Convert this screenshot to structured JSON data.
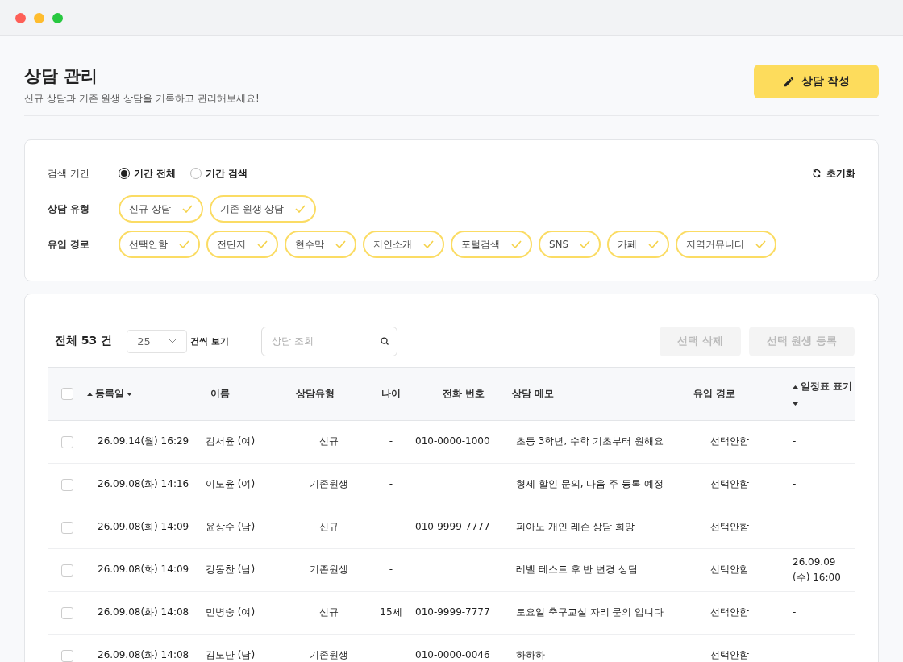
{
  "header": {
    "title": "상담 관리",
    "subtitle": "신규 상담과 기존 원생 상담을 기록하고 관리해보세요!",
    "write_button": "상담 작성"
  },
  "filters": {
    "period": {
      "label": "검색 기간",
      "options": [
        {
          "label": "기간 전체",
          "selected": true
        },
        {
          "label": "기간 검색",
          "selected": false
        }
      ]
    },
    "reset": "초기화",
    "consult_type": {
      "label": "상담 유형",
      "chips": [
        {
          "label": "신규 상담",
          "selected": true
        },
        {
          "label": "기존 원생 상담",
          "selected": true
        }
      ]
    },
    "source": {
      "label": "유입 경로",
      "chips": [
        {
          "label": "선택안함",
          "selected": true
        },
        {
          "label": "전단지",
          "selected": true
        },
        {
          "label": "현수막",
          "selected": true
        },
        {
          "label": "지인소개",
          "selected": true
        },
        {
          "label": "포털검색",
          "selected": true
        },
        {
          "label": "SNS",
          "selected": true
        },
        {
          "label": "카페",
          "selected": true
        },
        {
          "label": "지역커뮤니티",
          "selected": true
        }
      ]
    }
  },
  "list": {
    "total": "전체 53 건",
    "page_size": "25",
    "page_size_suffix": "건씩 보기",
    "search": {
      "placeholder": "상담 조회"
    },
    "buttons": [
      {
        "label": "선택 삭제",
        "disabled": true
      },
      {
        "label": "선택 원생 등록",
        "disabled": true
      }
    ],
    "table": {
      "select_all": {
        "checked": false
      },
      "columns": [
        "등록일",
        "이름",
        "상담유형",
        "나이",
        "전화 번호",
        "상담 메모",
        "유입 경로",
        "일정표 표기"
      ],
      "rows": [
        {
          "checked": false,
          "cells": [
            "26.09.14(월) 16:29",
            "김서윤 (여)",
            "신규",
            "-",
            "010-0000-1000",
            "초등 3학년, 수학 기초부터 원해요",
            "선택안함",
            "-"
          ]
        },
        {
          "checked": false,
          "cells": [
            "26.09.08(화) 14:16",
            "이도윤 (여)",
            "기존원생",
            "-",
            "",
            "형제 할인 문의, 다음 주 등록 예정",
            "선택안함",
            "-"
          ]
        },
        {
          "checked": false,
          "cells": [
            "26.09.08(화) 14:09",
            "윤상수 (남)",
            "신규",
            "-",
            "010-9999-7777",
            "피아노 개인 레슨 상담 희망",
            "선택안함",
            "-"
          ]
        },
        {
          "checked": false,
          "cells": [
            "26.09.08(화) 14:09",
            "강동찬 (남)",
            "기존원생",
            "-",
            "",
            "레벨 테스트 후 반 변경 상담",
            "선택안함",
            "26.09.09 (수) 16:00"
          ]
        },
        {
          "checked": false,
          "cells": [
            "26.09.08(화) 14:08",
            "민병숭 (여)",
            "신규",
            "15세",
            "010-9999-7777",
            "토요일 축구교실 자리 문의 입니다",
            "선택안함",
            "-"
          ]
        },
        {
          "checked": false,
          "cells": [
            "26.09.08(화) 14:08",
            "김도난 (남)",
            "기존원생",
            "",
            "010-0000-0046",
            "하하하",
            "선택안함",
            ""
          ]
        }
      ]
    }
  }
}
